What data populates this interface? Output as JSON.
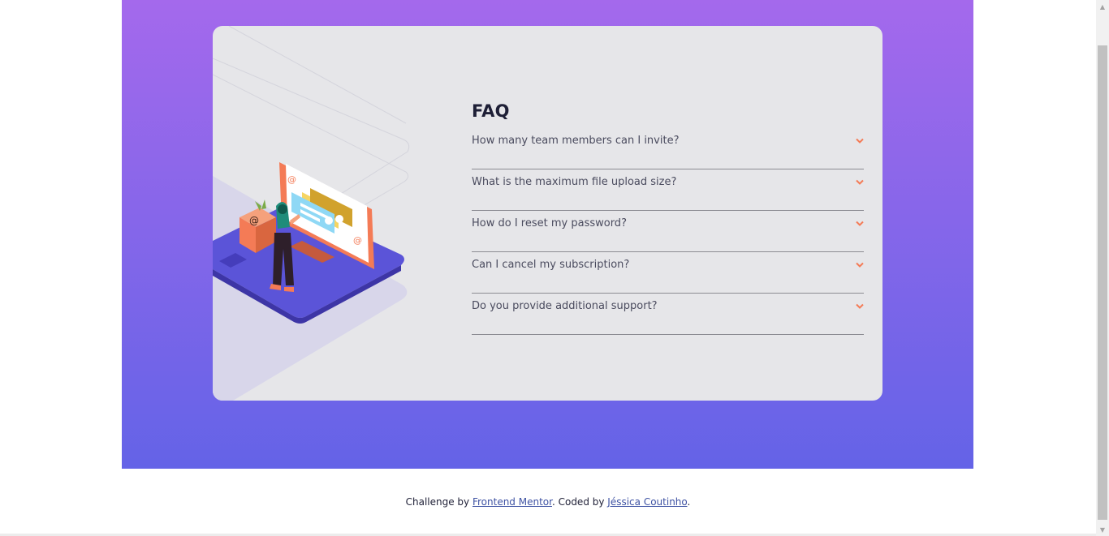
{
  "faq": {
    "title": "FAQ",
    "items": [
      {
        "question": "How many team members can I invite?"
      },
      {
        "question": "What is the maximum file upload size?"
      },
      {
        "question": "How do I reset my password?"
      },
      {
        "question": "Can I cancel my subscription?"
      },
      {
        "question": "Do you provide additional support?"
      }
    ],
    "chevron_icon": "chevron-down-icon"
  },
  "footer": {
    "prefix": "Challenge by ",
    "link1": "Frontend Mentor",
    "middle": ". Coded by ",
    "link2": "Jéssica Coutinho",
    "suffix": "."
  },
  "colors": {
    "gradient_top": "#a469ec",
    "gradient_bottom": "#6463e7",
    "card_bg": "#e6e6e9",
    "accent": "#f47b56",
    "title": "#1e1f36",
    "question_text": "#4a4b5e",
    "divider": "#8b8b92",
    "link": "#3e52a3"
  }
}
